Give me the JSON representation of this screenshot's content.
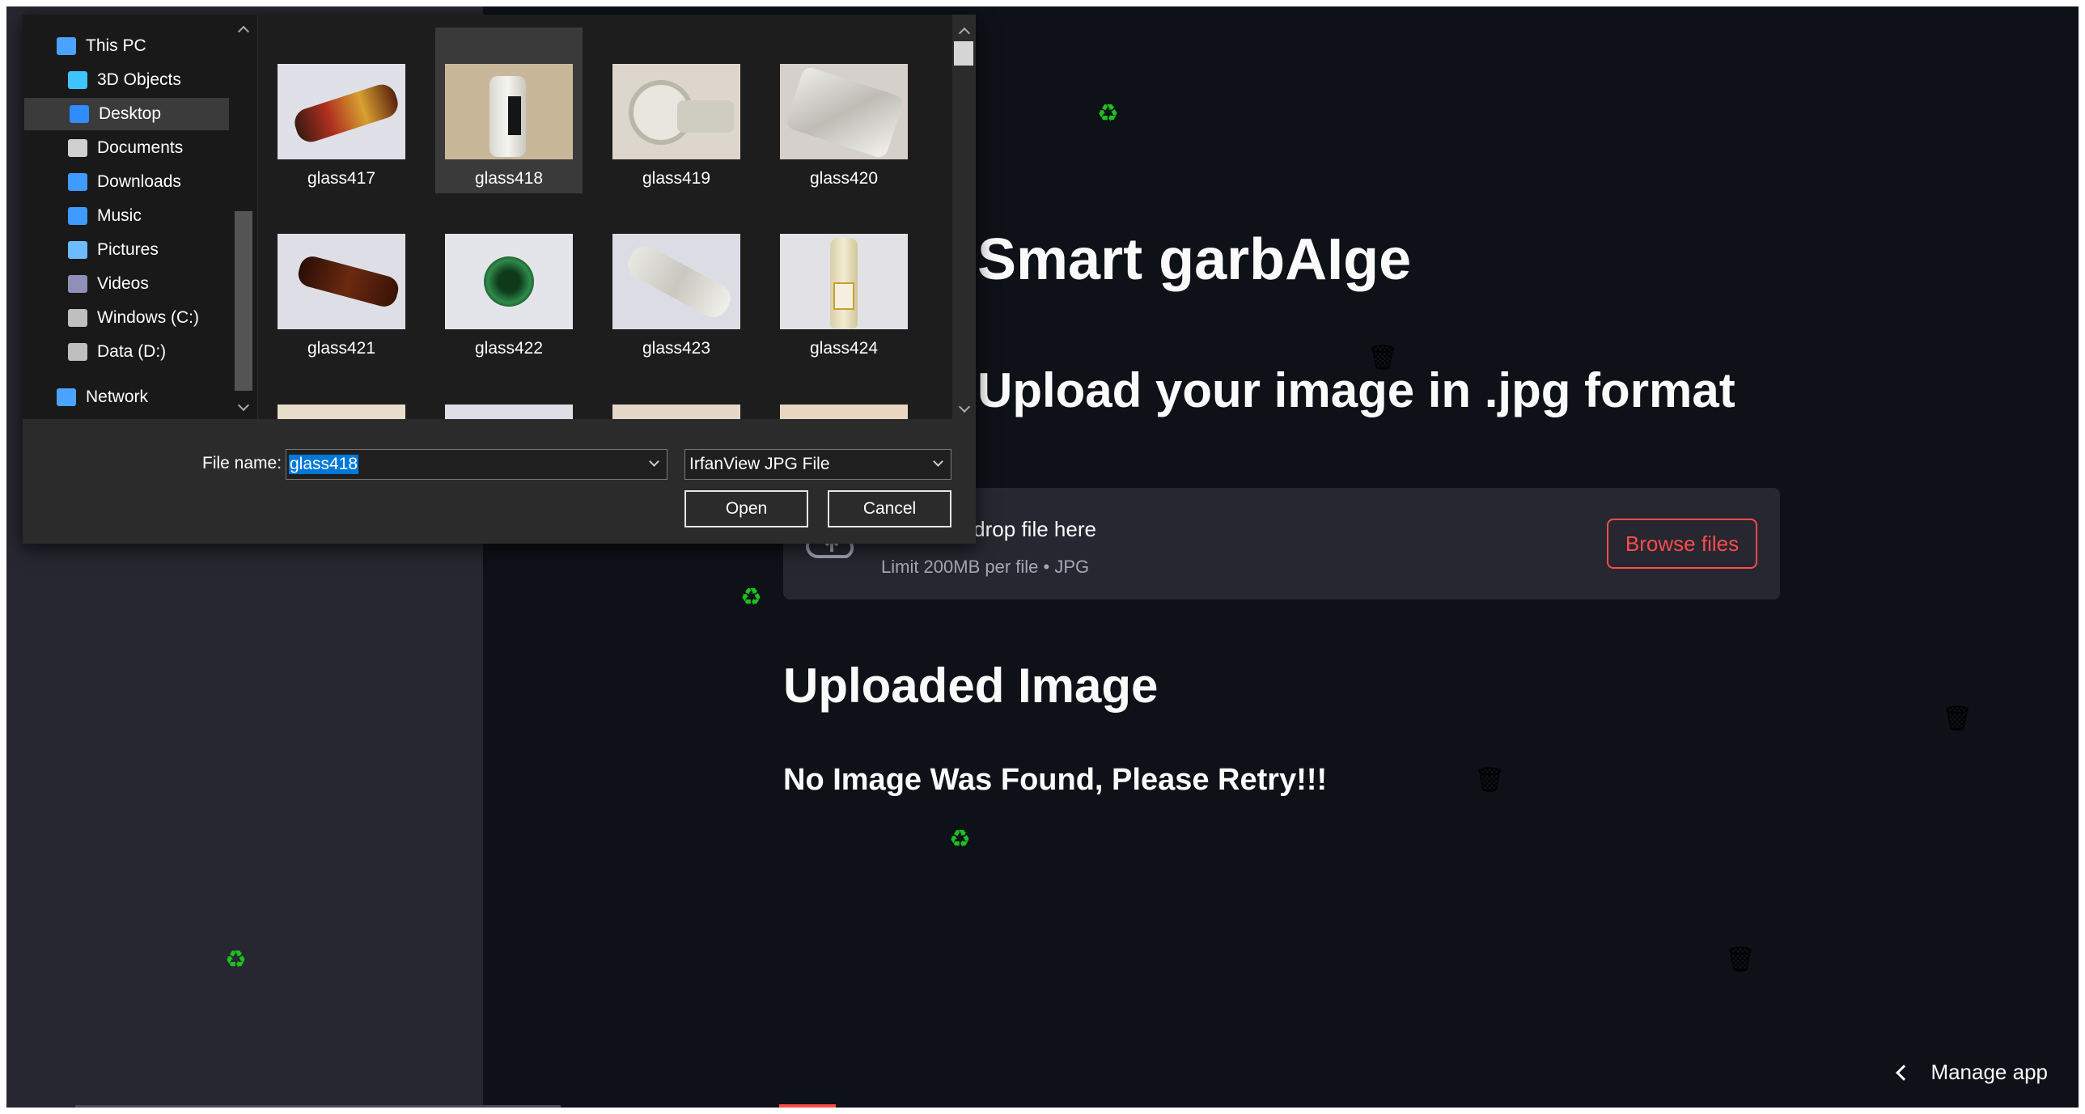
{
  "app": {
    "title": "Smart garbAIge",
    "subheading": "Upload your image in .jpg format",
    "uploader": {
      "drop_text": "Drag and drop file here",
      "limit_text": "Limit 200MB per file • JPG",
      "browse_label": "Browse files"
    },
    "section_title": "Uploaded Image",
    "error_text": "No Image Was Found, Please Retry!!!",
    "manage_app": "Manage app"
  },
  "decorations": {
    "recycle_icon": "♻",
    "trash_icon": "🗑"
  },
  "file_dialog": {
    "nav_items": [
      {
        "label": "This PC",
        "icon": "computer-icon",
        "color": "#4aa3ff"
      },
      {
        "label": "3D Objects",
        "icon": "cube-icon",
        "color": "#3fc4ff"
      },
      {
        "label": "Desktop",
        "icon": "desktop-icon",
        "color": "#2f8cff",
        "selected": true
      },
      {
        "label": "Documents",
        "icon": "document-icon",
        "color": "#d0d0d0"
      },
      {
        "label": "Downloads",
        "icon": "download-icon",
        "color": "#3f9bff"
      },
      {
        "label": "Music",
        "icon": "music-icon",
        "color": "#3f9bff"
      },
      {
        "label": "Pictures",
        "icon": "pictures-icon",
        "color": "#6cbcff"
      },
      {
        "label": "Videos",
        "icon": "videos-icon",
        "color": "#8f8fb8"
      },
      {
        "label": "Windows (C:)",
        "icon": "drive-c-icon",
        "color": "#bfbfbf"
      },
      {
        "label": "Data (D:)",
        "icon": "drive-d-icon",
        "color": "#bfbfbf"
      },
      {
        "label": "Network",
        "icon": "network-icon",
        "color": "#4aa3ff"
      }
    ],
    "files": [
      {
        "name": "glass417"
      },
      {
        "name": "glass418",
        "selected": true
      },
      {
        "name": "glass419"
      },
      {
        "name": "glass420"
      },
      {
        "name": "glass421"
      },
      {
        "name": "glass422"
      },
      {
        "name": "glass423"
      },
      {
        "name": "glass424"
      }
    ],
    "file_name_label": "File name:",
    "file_name_value": "glass418",
    "file_type_value": "IrfanView JPG File",
    "open_label": "Open",
    "cancel_label": "Cancel"
  }
}
